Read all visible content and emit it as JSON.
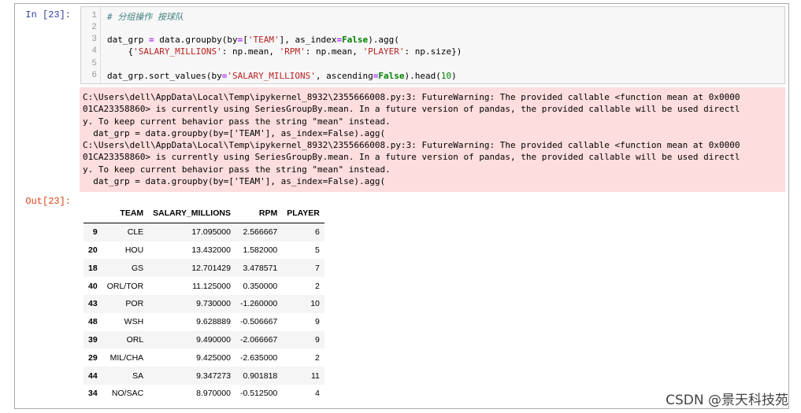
{
  "cell": {
    "in_prompt": "In  [23]:",
    "out_prompt": "Out[23]:",
    "line_numbers": [
      "1",
      "2",
      "3",
      "4",
      "5",
      "6"
    ],
    "code": {
      "l1_comment": "# 分组操作 按球队",
      "l3_a": "dat_grp ",
      "l3_eq1": "=",
      "l3_b": " data.groupby(by",
      "l3_eq2": "=",
      "l3_c": "[",
      "l3_str": "'TEAM'",
      "l3_d": "], as_index",
      "l3_eq3": "=",
      "l3_kw": "False",
      "l3_e": ").agg(",
      "l4_a": "    {",
      "l4_s1": "'SALARY_MILLIONS'",
      "l4_b": ": np.mean, ",
      "l4_s2": "'RPM'",
      "l4_c": ": np.mean, ",
      "l4_s3": "'PLAYER'",
      "l4_d": ": np.size})",
      "l6_a": "dat_grp.sort_values(by",
      "l6_eq1": "=",
      "l6_str": "'SALARY_MILLIONS'",
      "l6_b": ", ascending",
      "l6_eq2": "=",
      "l6_kw": "False",
      "l6_c": ").head(",
      "l6_num": "10",
      "l6_d": ")"
    }
  },
  "stderr_lines": [
    "C:\\Users\\dell\\AppData\\Local\\Temp\\ipykernel_8932\\2355666008.py:3: FutureWarning: The provided callable <function mean at 0x0000",
    "01CA23358860> is currently using SeriesGroupBy.mean. In a future version of pandas, the provided callable will be used directl",
    "y. To keep current behavior pass the string \"mean\" instead.",
    "  dat_grp = data.groupby(by=['TEAM'], as_index=False).agg(",
    "C:\\Users\\dell\\AppData\\Local\\Temp\\ipykernel_8932\\2355666008.py:3: FutureWarning: The provided callable <function mean at 0x0000",
    "01CA23358860> is currently using SeriesGroupBy.mean. In a future version of pandas, the provided callable will be used directl",
    "y. To keep current behavior pass the string \"mean\" instead.",
    "  dat_grp = data.groupby(by=['TEAM'], as_index=False).agg("
  ],
  "table": {
    "index_header": "",
    "columns": [
      "TEAM",
      "SALARY_MILLIONS",
      "RPM",
      "PLAYER"
    ],
    "rows": [
      {
        "index": "9",
        "cells": [
          "CLE",
          "17.095000",
          "2.566667",
          "6"
        ]
      },
      {
        "index": "20",
        "cells": [
          "HOU",
          "13.432000",
          "1.582000",
          "5"
        ]
      },
      {
        "index": "18",
        "cells": [
          "GS",
          "12.701429",
          "3.478571",
          "7"
        ]
      },
      {
        "index": "40",
        "cells": [
          "ORL/TOR",
          "11.125000",
          "0.350000",
          "2"
        ]
      },
      {
        "index": "43",
        "cells": [
          "POR",
          "9.730000",
          "-1.260000",
          "10"
        ]
      },
      {
        "index": "48",
        "cells": [
          "WSH",
          "9.628889",
          "-0.506667",
          "9"
        ]
      },
      {
        "index": "39",
        "cells": [
          "ORL",
          "9.490000",
          "-2.066667",
          "9"
        ]
      },
      {
        "index": "29",
        "cells": [
          "MIL/CHA",
          "9.425000",
          "-2.635000",
          "2"
        ]
      },
      {
        "index": "44",
        "cells": [
          "SA",
          "9.347273",
          "0.901818",
          "11"
        ]
      },
      {
        "index": "34",
        "cells": [
          "NO/SAC",
          "8.970000",
          "-0.512500",
          "4"
        ]
      }
    ]
  },
  "watermark": "CSDN @景天科技苑"
}
